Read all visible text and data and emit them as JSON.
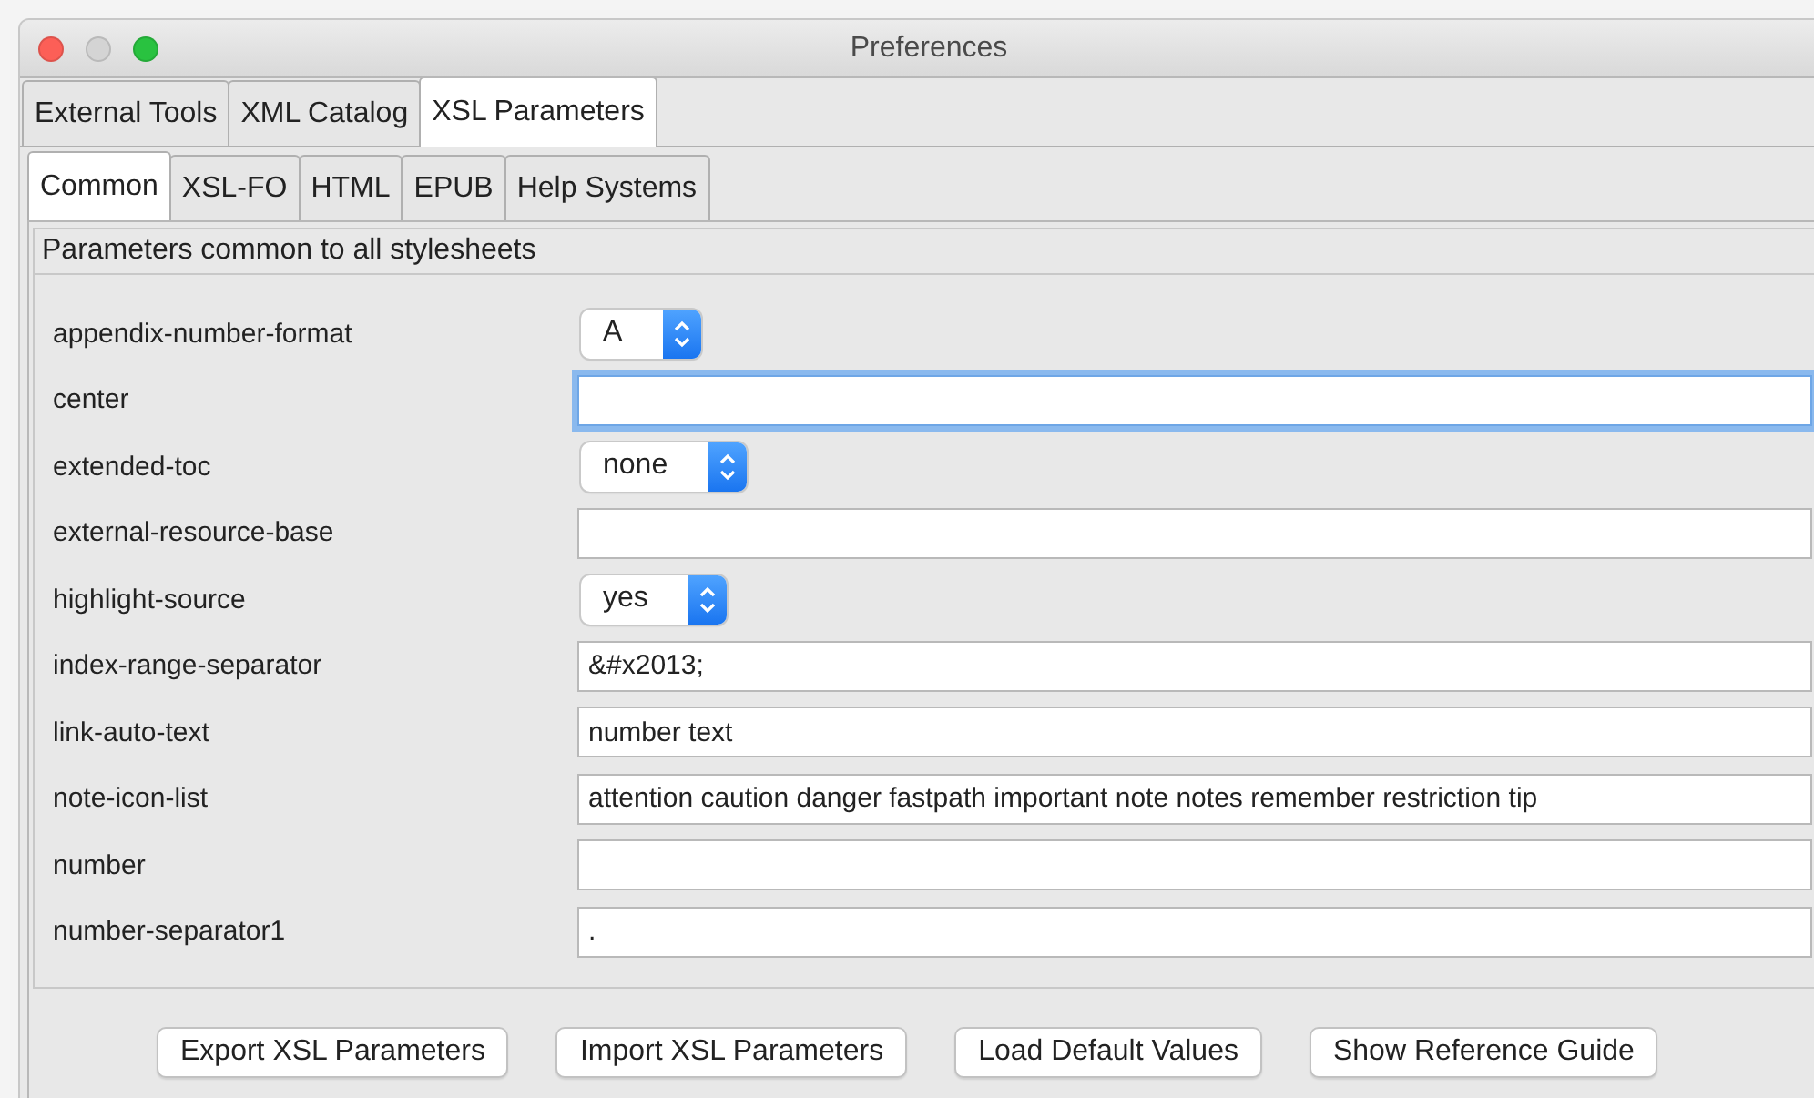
{
  "window": {
    "title": "Preferences"
  },
  "tabs": [
    {
      "label": "External Tools",
      "selected": false
    },
    {
      "label": "XML Catalog",
      "selected": false
    },
    {
      "label": "XSL Parameters",
      "selected": true
    }
  ],
  "subtabs": [
    {
      "label": "Common",
      "selected": true
    },
    {
      "label": "XSL-FO",
      "selected": false
    },
    {
      "label": "HTML",
      "selected": false
    },
    {
      "label": "EPUB",
      "selected": false
    },
    {
      "label": "Help Systems",
      "selected": false
    }
  ],
  "section_title": "Parameters common to all stylesheets",
  "parameters": [
    {
      "name": "appendix-number-format",
      "kind": "select",
      "value": "A"
    },
    {
      "name": "center",
      "kind": "text",
      "focused": true
    },
    {
      "name": "extended-toc",
      "kind": "select",
      "value": "none"
    },
    {
      "name": "external-resource-base",
      "kind": "text",
      "focused": false
    },
    {
      "name": "highlight-source",
      "kind": "select",
      "value": "yes"
    },
    {
      "name": "index-range-separator",
      "kind": "text",
      "value": "&#x2013;",
      "focused": false
    },
    {
      "name": "link-auto-text",
      "kind": "text",
      "value": "number text",
      "focused": false
    },
    {
      "name": "note-icon-list",
      "kind": "text",
      "value": "attention caution danger fastpath important note notes remember restriction tip",
      "focused": false
    },
    {
      "name": "number",
      "kind": "text",
      "focused": false
    },
    {
      "name": "number-separator1",
      "kind": "text",
      "value": ".",
      "focused": false
    }
  ],
  "buttons": [
    "Export XSL Parameters",
    "Import XSL Parameters",
    "Load Default Values",
    "Show Reference Guide"
  ]
}
